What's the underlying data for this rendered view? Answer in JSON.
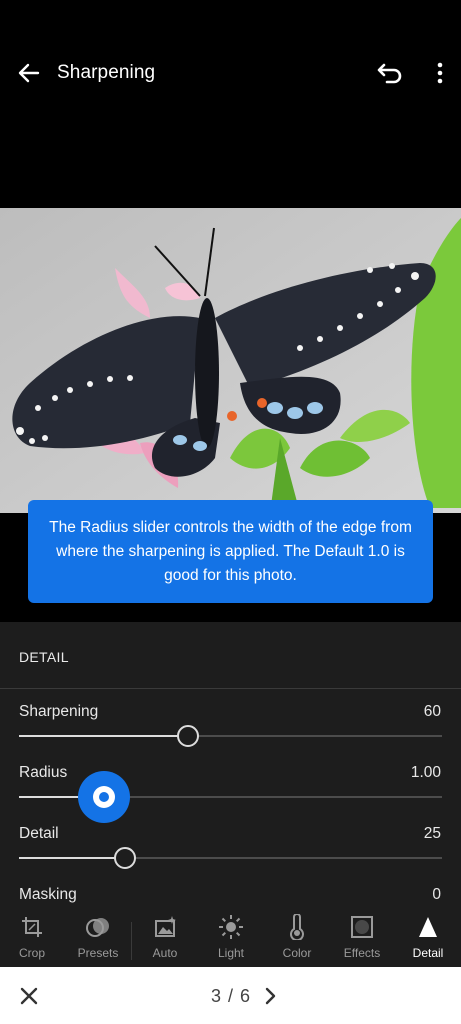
{
  "header": {
    "title": "Sharpening"
  },
  "tooltip": {
    "text": "The Radius slider controls the width of the edge from where the sharpening is applied. The Default 1.0 is good for this photo."
  },
  "panel": {
    "header": "DETAIL",
    "sliders": [
      {
        "label": "Sharpening",
        "value": "60",
        "level": 0.4
      },
      {
        "label": "Radius",
        "value": "1.00",
        "level": 0.2
      },
      {
        "label": "Detail",
        "value": "25",
        "level": 0.25
      },
      {
        "label": "Masking",
        "value": "0",
        "level": 0.0
      }
    ]
  },
  "toolbar": {
    "items": [
      {
        "label": "Crop",
        "icon": "crop-icon"
      },
      {
        "label": "Presets",
        "icon": "presets-icon"
      },
      {
        "label": "Auto",
        "icon": "auto-icon"
      },
      {
        "label": "Light",
        "icon": "light-icon"
      },
      {
        "label": "Color",
        "icon": "color-icon"
      },
      {
        "label": "Effects",
        "icon": "effects-icon"
      },
      {
        "label": "Detail",
        "icon": "detail-icon",
        "active": true
      }
    ]
  },
  "footer": {
    "page": "3 / 6"
  },
  "colors": {
    "accent": "#1473e6",
    "panel": "#1d1d1d",
    "background": "#000000"
  }
}
